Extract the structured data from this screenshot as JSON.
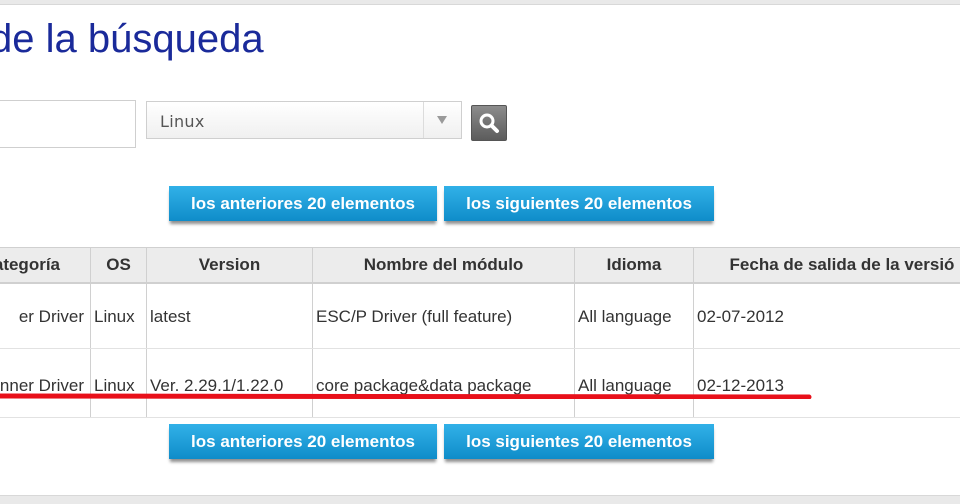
{
  "page_title": "de la búsqueda",
  "search": {
    "keyword_value": "",
    "os_selected": "Linux"
  },
  "pager": {
    "prev_label": "los anteriores 20 elementos",
    "next_label": "los siguientes 20 elementos"
  },
  "table": {
    "headers": [
      "ategoría",
      "OS",
      "Version",
      "Nombre del módulo",
      "Idioma",
      "Fecha de salida de la versió"
    ],
    "rows": [
      [
        "er Driver",
        "Linux",
        "latest",
        "ESC/P Driver (full feature)",
        "All language",
        "02-07-2012"
      ],
      [
        "nner Driver",
        "Linux",
        "Ver. 2.29.1/1.22.0",
        "core package&data package",
        "All language",
        "02-12-2013"
      ]
    ]
  },
  "colors": {
    "title": "#1a2a9a",
    "button": "#1a9ad6",
    "annotation": "#e8101a"
  }
}
